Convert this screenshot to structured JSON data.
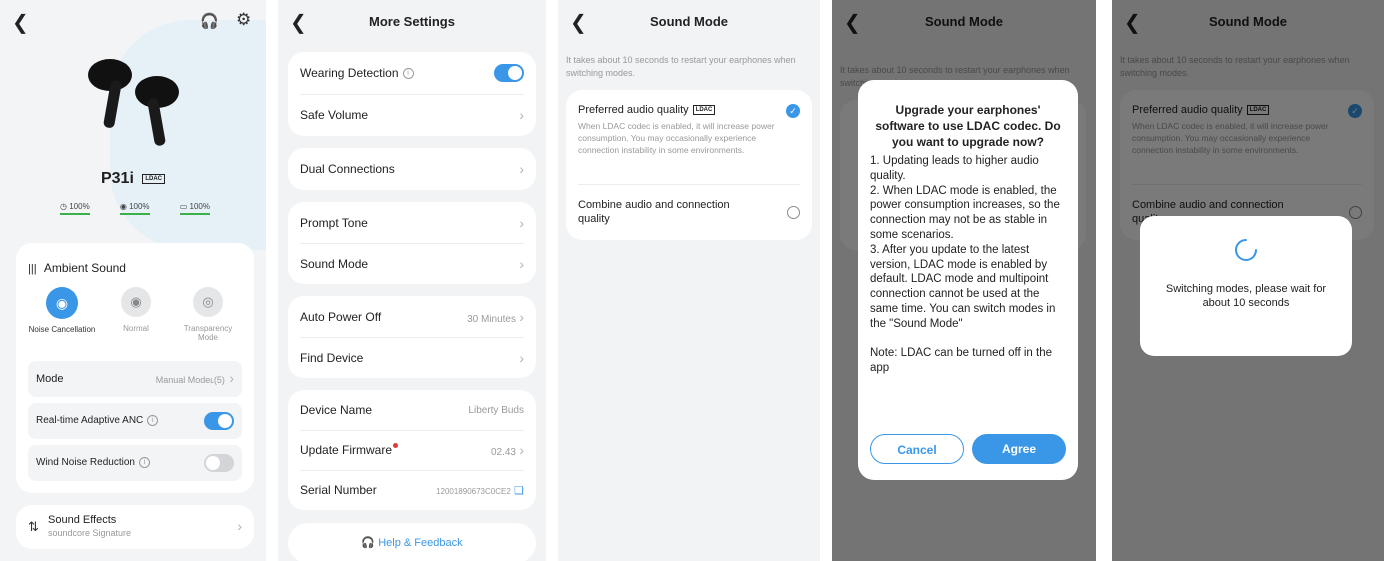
{
  "screen1": {
    "product_name": "P31i",
    "ldac_badge": "LDAC",
    "battery": [
      "100%",
      "100%",
      "100%"
    ],
    "ambient": {
      "title": "Ambient Sound",
      "modes": [
        "Noise Cancellation",
        "Normal",
        "Transparency Mode"
      ],
      "mode_label": "Mode",
      "mode_value": "Manual Modeʟ(5)",
      "adaptive_label": "Real-time Adaptive ANC",
      "wind_label": "Wind Noise Reduction"
    },
    "sound_effects": {
      "title": "Sound Effects",
      "subtitle": "soundcore Signature"
    }
  },
  "screen2": {
    "title": "More Settings",
    "wearing_detection": "Wearing Detection",
    "safe_volume": "Safe Volume",
    "dual_connections": "Dual Connections",
    "prompt_tone": "Prompt Tone",
    "sound_mode": "Sound Mode",
    "auto_power_off": "Auto Power Off",
    "auto_power_off_value": "30 Minutes",
    "find_device": "Find Device",
    "device_name": "Device Name",
    "device_name_value": "Liberty Buds",
    "update_firmware": "Update Firmware",
    "firmware_value": "02.43",
    "serial_number": "Serial Number",
    "serial_value": "12001890673C0CE2",
    "help": "Help & Feedback"
  },
  "sound_mode": {
    "title": "Sound Mode",
    "notice": "It takes about 10 seconds to restart your earphones when switching modes.",
    "opt1_title": "Preferred audio quality",
    "opt1_desc": "When LDAC codec is enabled, it will increase power consumption. You may occasionally experience connection instability in some environments.",
    "opt2_title": "Combine audio and connection quality"
  },
  "dialog": {
    "title": "Upgrade your earphones' software to use LDAC codec. Do you want to upgrade now?",
    "body": "1. Updating leads to higher audio quality.\n2. When LDAC mode is enabled, the power consumption increases, so the connection may not be as stable in some scenarios.\n3. After you update to the latest version, LDAC mode is enabled by default. LDAC mode and multipoint connection cannot be used at the same time. You can switch modes in the \"Sound Mode\"\n\nNote: LDAC can be turned off in the app",
    "cancel": "Cancel",
    "agree": "Agree"
  },
  "switching": {
    "message": "Switching modes, please wait for about 10 seconds"
  },
  "colors": {
    "accent": "#3a97e8",
    "battery_green": "#3cb14a",
    "firmware_dot": "#e03a3a"
  }
}
